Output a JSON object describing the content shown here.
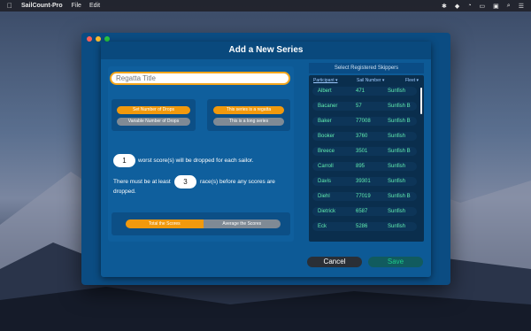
{
  "menubar": {
    "app_name": "SailCount-Pro",
    "menus": [
      "File",
      "Edit"
    ],
    "status_icons": [
      "bluetooth-icon",
      "dropbox-icon",
      "wifi-icon",
      "airplay-icon",
      "display-icon",
      "spotlight-icon",
      "control-center-icon"
    ]
  },
  "dialog": {
    "title": "Add a New Series",
    "regatta_title_placeholder": "Regatta Title",
    "drops_options": [
      "Set Number of Drops",
      "Variable Number of Drops"
    ],
    "series_type_options": [
      "This series is a regatta",
      "This is a long series"
    ],
    "drops_count": "1",
    "drops_text": "worst score(s) will be dropped for each sailor.",
    "min_races_pre": "There must be at least",
    "min_races_count": "3",
    "min_races_post_1": "race(s) before any scores are",
    "min_races_post_2": "dropped.",
    "score_mode": [
      "Total the Scores",
      "Average the Scores"
    ],
    "cancel_label": "Cancel",
    "save_label": "Save"
  },
  "skippers": {
    "header": "Select Registered Skippers",
    "columns": [
      "Participant",
      "Sail Number",
      "Fleet"
    ],
    "rows": [
      [
        "Albert",
        "471",
        "Sunfish"
      ],
      [
        "Bacaner",
        "57",
        "Sunfish B"
      ],
      [
        "Baker",
        "77008",
        "Sunfish B"
      ],
      [
        "Booker",
        "3760",
        "Sunfish"
      ],
      [
        "Breece",
        "3501",
        "Sunfish B"
      ],
      [
        "Carroll",
        "895",
        "Sunfish"
      ],
      [
        "Davis",
        "39301",
        "Sunfish"
      ],
      [
        "Diehl",
        "77019",
        "Sunfish B"
      ],
      [
        "Dietrick",
        "6587",
        "Sunfish"
      ],
      [
        "Eck",
        "5286",
        "Sunfish"
      ]
    ]
  },
  "colors": {
    "accent": "#f1990d",
    "sheet_bg": "#0d5a96",
    "list_text": "#62f0b0"
  }
}
